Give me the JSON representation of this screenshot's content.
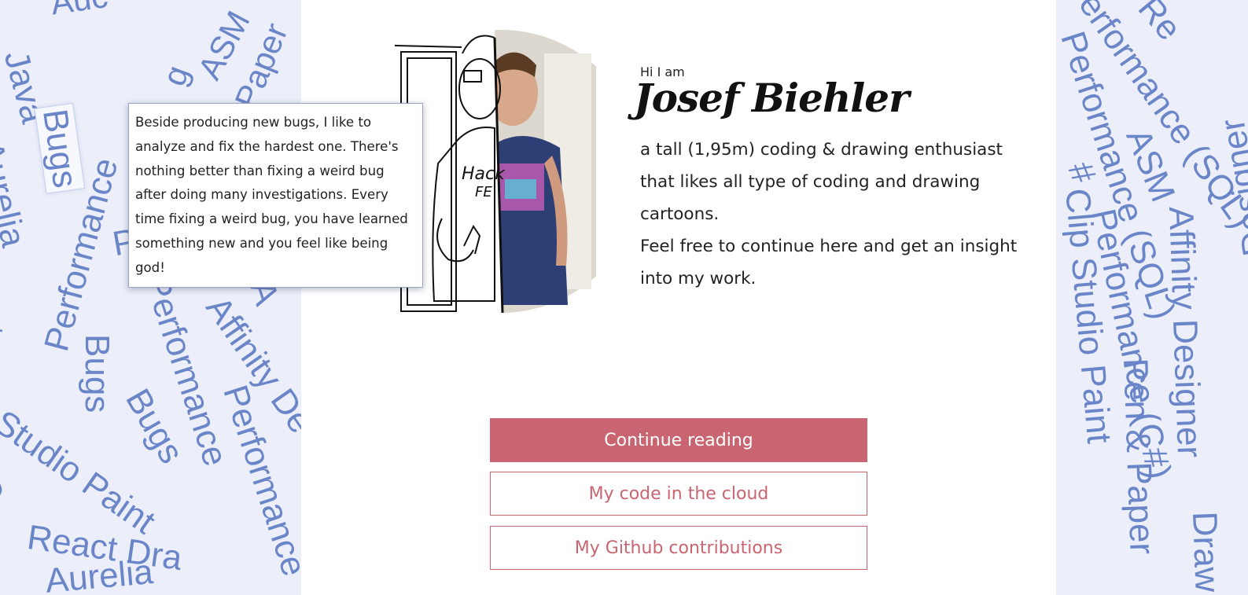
{
  "background": {
    "left_words": [
      "Aurelia",
      "ASM",
      "Paper",
      "Java",
      "(SQL)",
      "Bugs",
      "g",
      "Aurelia",
      "Performance",
      "P",
      "Performance",
      "Affinity De",
      "Bugs",
      "Bugs",
      "Performance (SQL)",
      "Performance",
      "Studio Paint",
      "React Dra",
      "C",
      "t",
      "A",
      "Auc"
    ],
    "right_words": [
      "Performance (SQL)",
      "Performance (SQL)",
      "ASM",
      "#",
      "Affinity Designer",
      "Performance (C#)",
      "Clip Studio Paint",
      "Pen & Paper",
      "Affinity Designer",
      "Re",
      "Draw"
    ]
  },
  "tooltip": {
    "text": "Beside producing new bugs, I like to analyze and fix the hardest one. There's nothing better than fixing a weird bug after doing many investigations. Every time fixing a weird bug, you have learned something new and you feel like being god!"
  },
  "intro": {
    "greeting": "Hi I am",
    "name": "Josef Biehler",
    "bio_line1": "a tall (1,95m) coding & drawing enthusiast that likes all type of coding and drawing cartoons.",
    "bio_line2": "Feel free to continue here and get an insight into my work."
  },
  "buttons": {
    "continue": "Continue reading",
    "code_cloud": "My code in the cloud",
    "github": "My Github contributions"
  },
  "colors": {
    "accent": "#c96570",
    "side_bg": "#eceff9",
    "word_color": "#6b86c8"
  }
}
